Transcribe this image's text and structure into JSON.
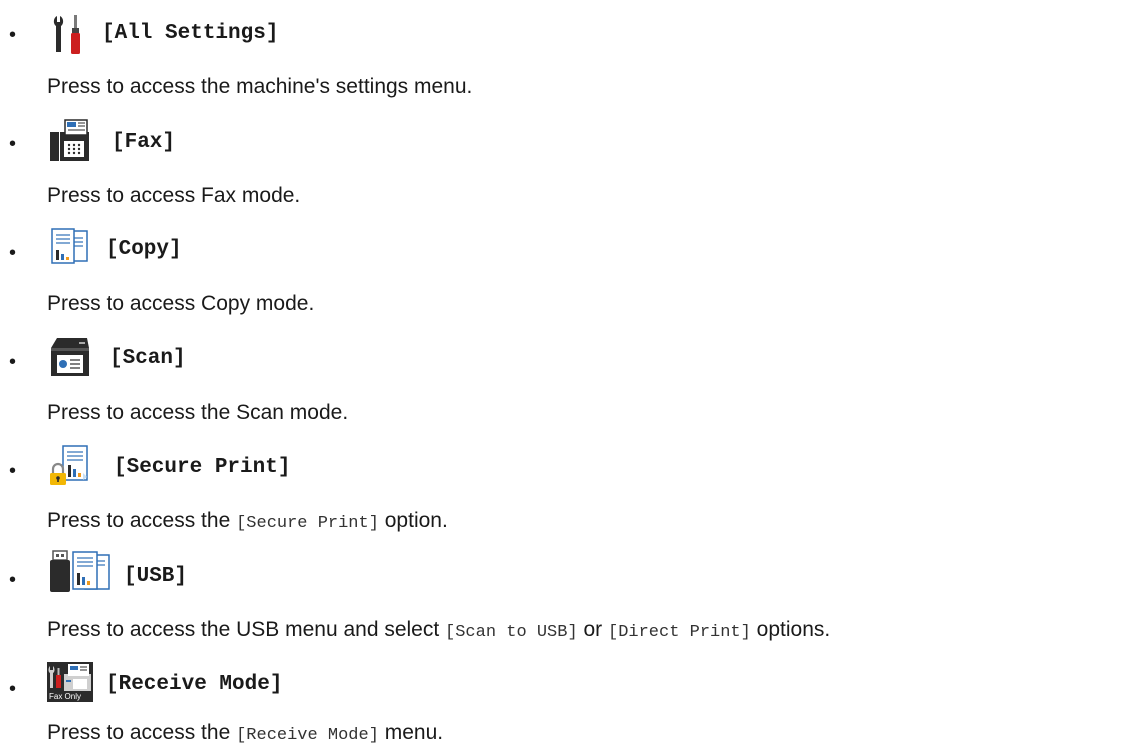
{
  "items": [
    {
      "icon": "wrench-screwdriver-settings-icon",
      "label": "[All Settings]",
      "desc": "Press to access the machine's settings menu."
    },
    {
      "icon": "fax-machine-icon",
      "label": "[Fax]",
      "desc": "Press to access Fax mode."
    },
    {
      "icon": "copy-documents-icon",
      "label": "[Copy]",
      "desc": "Press to access Copy mode."
    },
    {
      "icon": "scanner-icon",
      "label": "[Scan]",
      "desc": "Press to access the Scan mode."
    },
    {
      "icon": "secure-print-lock-icon",
      "label": "[Secure Print]",
      "desc_pre": "Press to access the ",
      "desc_code": "[Secure Print]",
      "desc_post": " option."
    },
    {
      "icon": "usb-drive-documents-icon",
      "label": "[USB]",
      "desc_pre": "Press to access the USB menu and select ",
      "desc_code": "[Scan to USB]",
      "desc_mid": " or ",
      "desc_code2": "[Direct Print]",
      "desc_post": " options."
    },
    {
      "icon": "receive-mode-fax-only-icon",
      "label": "[Receive Mode]",
      "icon_caption": "Fax Only",
      "desc_pre": "Press to access the ",
      "desc_code": "[Receive Mode]",
      "desc_post": " menu."
    }
  ],
  "colors": {
    "text": "#1a1a1a",
    "icon_dark": "#2b2b2b",
    "icon_blue": "#2f6fb6",
    "icon_light_blue": "#c9dff3",
    "icon_red": "#cc1f1f",
    "icon_orange": "#f29b1d",
    "icon_lock_yellow": "#f2b705"
  }
}
